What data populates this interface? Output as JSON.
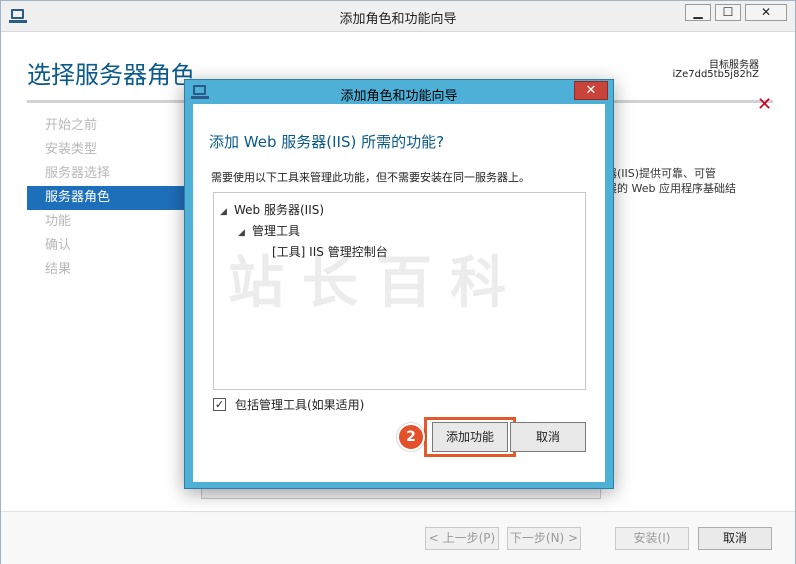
{
  "outer": {
    "title": "添加角色和功能向导",
    "minimize": "▁",
    "maximize": "☐",
    "close": "✕",
    "page_title": "选择服务器角色",
    "target_label": "目标服务器",
    "target_value": "iZe7dd5tb5j82hZ",
    "close_x": "✕",
    "nav_items": [
      "开始之前",
      "安装类型",
      "服务器选择",
      "服务器角色",
      "功能",
      "确认",
      "结果"
    ],
    "active_nav_index": 3,
    "description_lines": [
      "器(IIS)提供可靠、可管",
      "展的 Web 应用程序基础结"
    ],
    "footer": {
      "prev": "< 上一步(P)",
      "next": "下一步(N) >",
      "install": "安装(I)",
      "cancel": "取消"
    }
  },
  "dialog": {
    "title": "添加角色和功能向导",
    "close": "✕",
    "heading": "添加 Web 服务器(IIS) 所需的功能?",
    "subtitle": "需要使用以下工具来管理此功能，但不需要安装在同一服务器上。",
    "tree": [
      {
        "label": "Web 服务器(IIS)",
        "expanded": true,
        "level": 0
      },
      {
        "label": "管理工具",
        "expanded": true,
        "level": 1
      },
      {
        "label": "[工具] IIS 管理控制台",
        "expanded": false,
        "level": 2
      }
    ],
    "checkbox_label": "包括管理工具(如果适用)",
    "checkbox_checked": true,
    "add_button": "添加功能",
    "cancel_button": "取消",
    "step_badge": "2"
  },
  "colors": {
    "dialog_frame": "#4fb0d7",
    "accent_blue": "#0a5a8a",
    "nav_active": "#1e6fba",
    "highlight": "#e4582c"
  },
  "watermark": "站长百科"
}
